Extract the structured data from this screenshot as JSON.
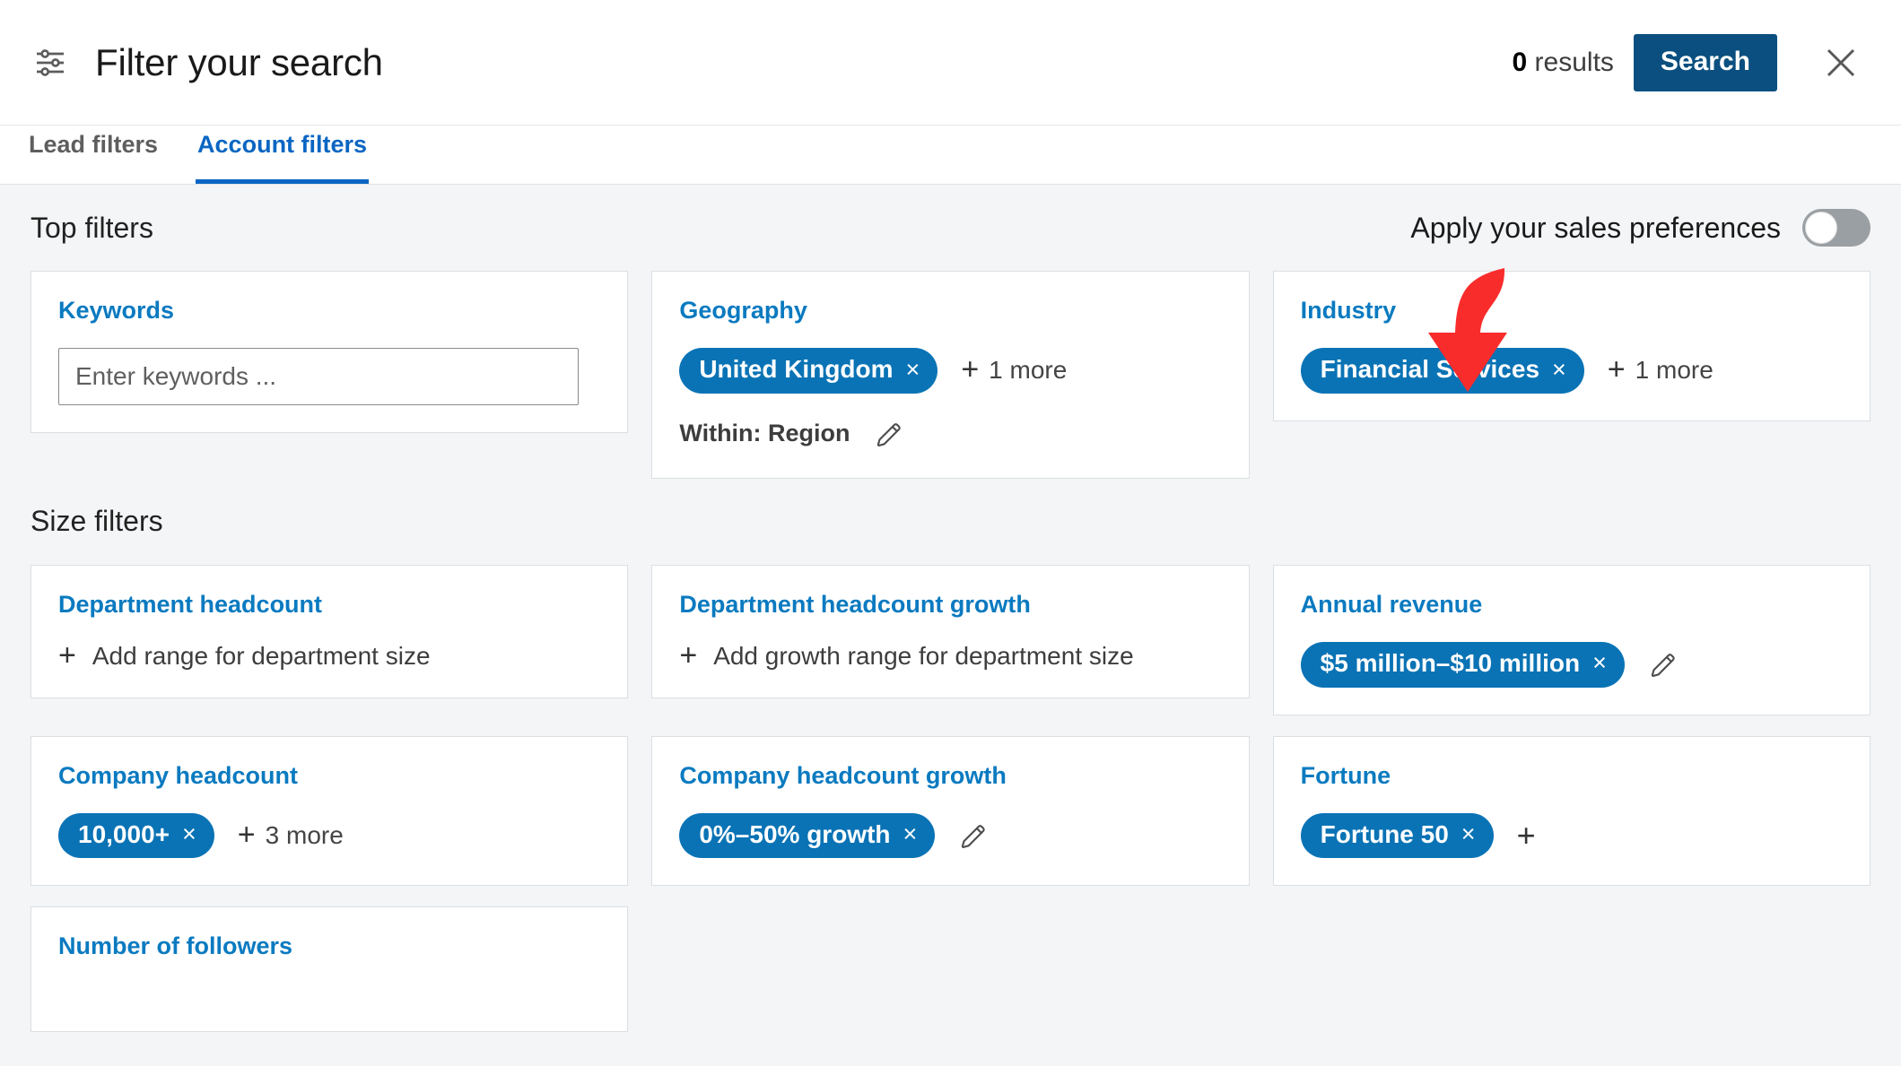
{
  "header": {
    "icon": "filter-sliders-icon",
    "title": "Filter your search",
    "results_count": "0",
    "results_label": " results",
    "search_label": "Search",
    "close_icon": "close-icon"
  },
  "tabs": [
    {
      "label": "Lead filters",
      "active": false
    },
    {
      "label": "Account filters",
      "active": true
    }
  ],
  "top_filters": {
    "section_title": "Top filters",
    "preferences_label": "Apply your sales preferences",
    "preferences_on": false,
    "cards": [
      {
        "title": "Keywords",
        "input_placeholder": "Enter keywords ...",
        "input_value": ""
      },
      {
        "title": "Geography",
        "pills": [
          {
            "label": "United Kingdom",
            "remove": "×"
          }
        ],
        "more": "+ 1 more",
        "more_count": "1 more",
        "within_label": "Within: Region",
        "edit_icon": "pencil-icon"
      },
      {
        "title": "Industry",
        "pills": [
          {
            "label": "Financial Services",
            "remove": "×"
          }
        ],
        "more": "+ 1 more",
        "more_count": "1 more"
      }
    ]
  },
  "size_filters": {
    "section_title": "Size filters",
    "cards": [
      {
        "title": "Department headcount",
        "add_label": "Add range for department size"
      },
      {
        "title": "Department headcount growth",
        "add_label": "Add growth range for department size"
      },
      {
        "title": "Annual revenue",
        "pills": [
          {
            "label": "$5 million–$10 million",
            "remove": "×"
          }
        ],
        "edit_icon": "pencil-icon"
      },
      {
        "title": "Company headcount",
        "pills": [
          {
            "label": "10,000+",
            "remove": "×"
          }
        ],
        "more_count": "3 more"
      },
      {
        "title": "Company headcount growth",
        "pills": [
          {
            "label": "0%–50% growth",
            "remove": "×"
          }
        ],
        "edit_icon": "pencil-icon"
      },
      {
        "title": "Fortune",
        "pills": [
          {
            "label": "Fortune 50",
            "remove": "×"
          }
        ],
        "add_icon": "plus-icon"
      },
      {
        "title": "Number of followers"
      }
    ]
  },
  "annotation": {
    "arrow_color": "#f92c2c",
    "arrow_target": "Financial Services pill"
  },
  "colors": {
    "accent_blue": "#0a66c2",
    "link_blue": "#0a7ac0",
    "pill_blue": "#0a73b5",
    "search_button": "#0a4f7f",
    "page_background": "#f3f5f7",
    "card_background": "#ffffff"
  }
}
